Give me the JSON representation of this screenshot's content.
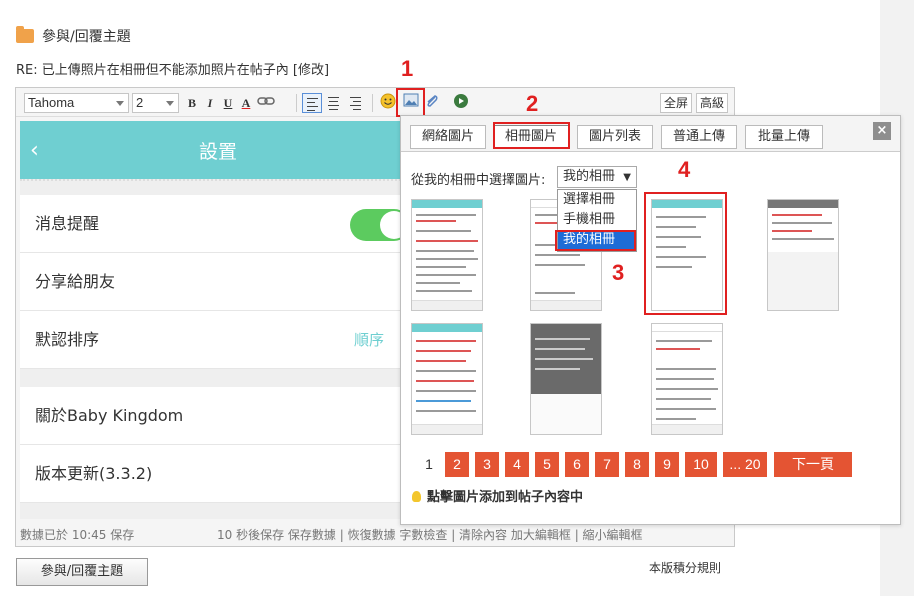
{
  "page": {
    "header_title": "參與/回覆主題",
    "subject": "RE: 已上傳照片在相冊但不能添加照片在帖子內 [修改]",
    "submit_label": "參與/回覆主題",
    "rules_label": "本版積分規則"
  },
  "toolbar": {
    "font_family": "Tahoma",
    "font_size": "2",
    "bold": "B",
    "italic": "I",
    "underline": "U",
    "text_color": "A",
    "fullscreen_label": "全屏",
    "advanced_label": "高級"
  },
  "annotations": [
    "1",
    "2",
    "3",
    "4"
  ],
  "phone": {
    "title": "設置",
    "rows": [
      {
        "label": "消息提醒"
      },
      {
        "label": "分享給朋友"
      },
      {
        "label": "默認排序",
        "value": "順序"
      },
      {
        "label": "關於Baby Kingdom"
      },
      {
        "label": "版本更新(3.3.2)"
      }
    ],
    "accent": "#6fcfd1"
  },
  "statusbar": {
    "saved": "數據已於 10:45 保存",
    "actions": "10 秒後保存 保存數據 | 恢復數據    字數檢查 | 清除內容    加大編輯框 | 縮小編輯框"
  },
  "dialog": {
    "tabs": [
      "網絡圖片",
      "相冊圖片",
      "圖片列表",
      "普通上傳",
      "批量上傳"
    ],
    "active_tab": "相冊圖片",
    "close": "×",
    "album_label": "從我的相冊中選擇圖片:",
    "album_selected": "我的相冊",
    "album_options": [
      "選擇相冊",
      "手機相冊",
      "我的相冊"
    ],
    "pages": [
      "1",
      "2",
      "3",
      "4",
      "5",
      "6",
      "7",
      "8",
      "9",
      "10",
      "... 20",
      "下一頁"
    ],
    "current_page": "1",
    "tip": "點擊圖片添加到帖子內容中",
    "pager_color": "#e45433"
  }
}
